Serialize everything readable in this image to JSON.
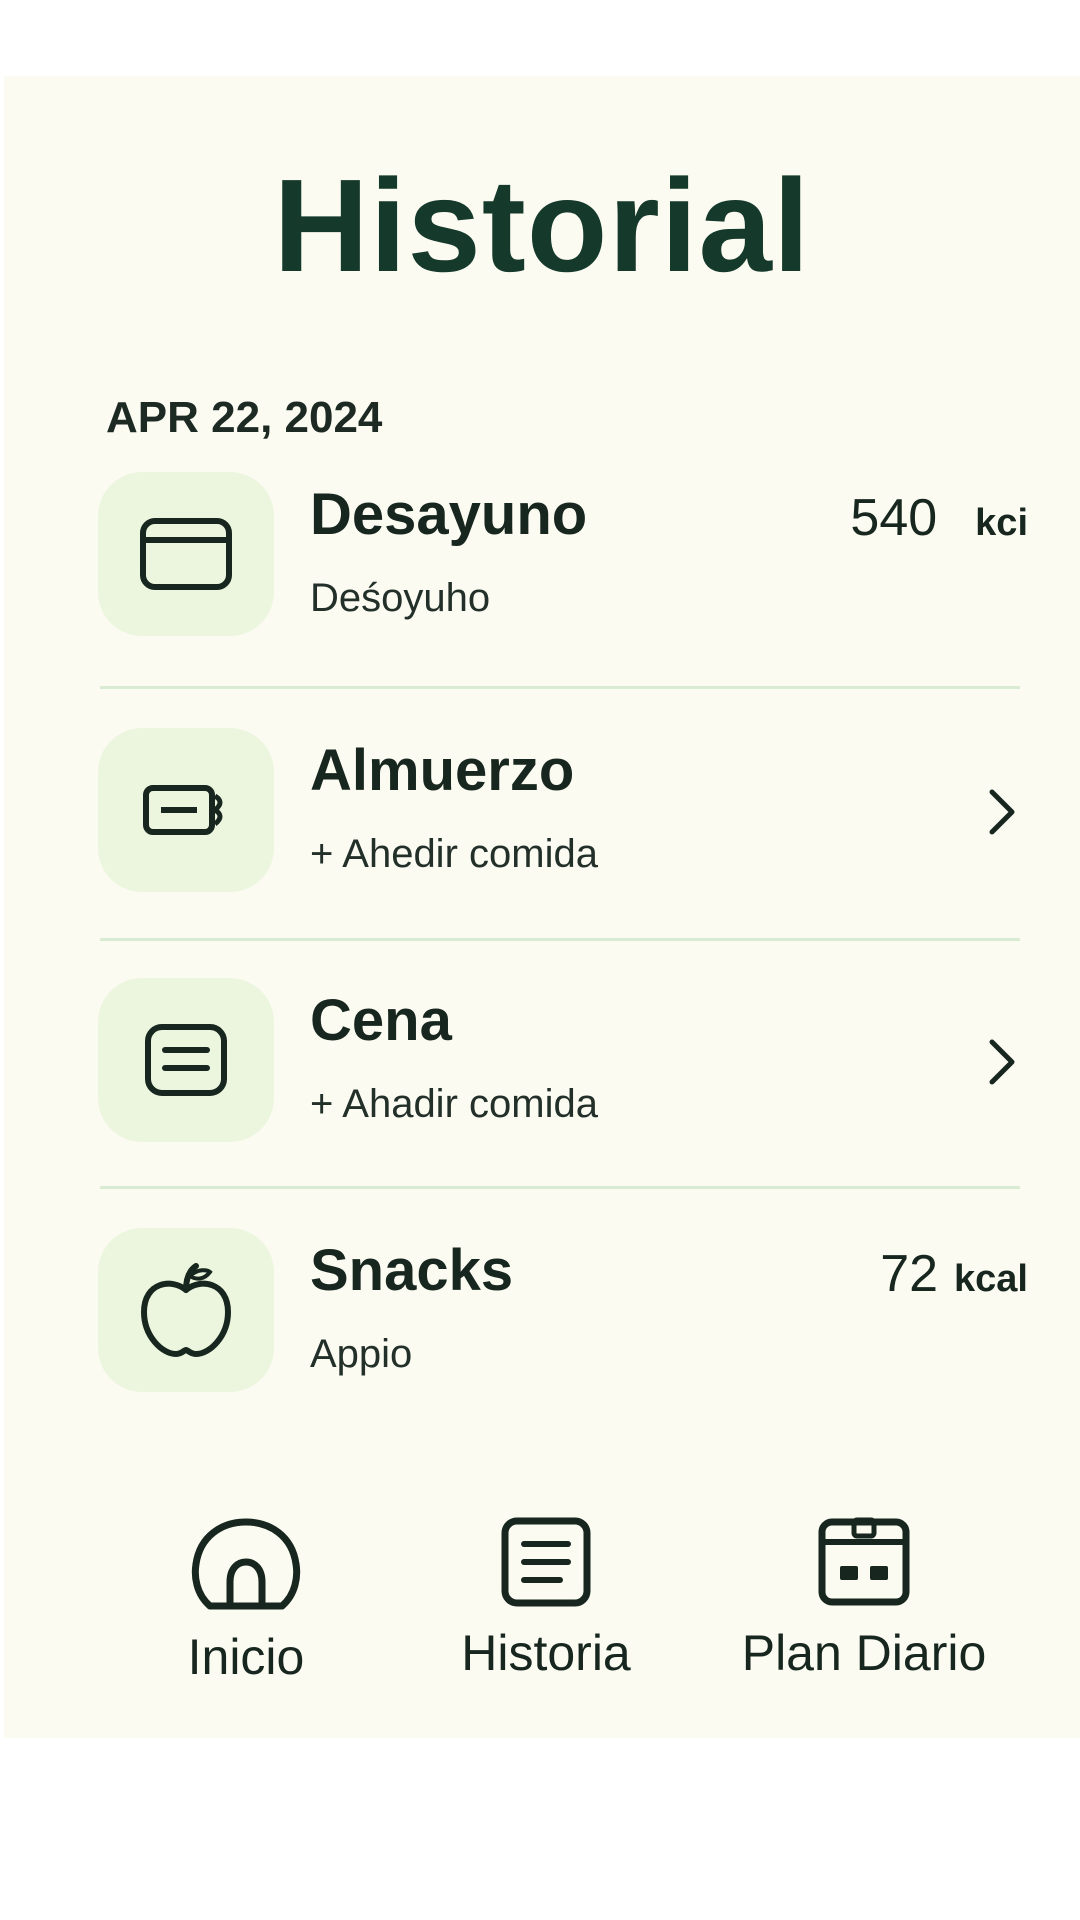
{
  "header": {
    "title": "Historial"
  },
  "date": "APR 22, 2024",
  "meals": [
    {
      "name": "Desayuno",
      "subtitle": "Deśoyuho",
      "calories": "540",
      "unit": "kci",
      "icon": "card-icon"
    },
    {
      "name": "Almuerzo",
      "subtitle": "+ Ahedir comida",
      "icon": "lunchbox-icon"
    },
    {
      "name": "Cena",
      "subtitle": "+ Ahadir comida",
      "icon": "notes-icon"
    },
    {
      "name": "Snacks",
      "subtitle": "Appio",
      "calories": "72",
      "unit": "kcal",
      "icon": "apple-icon"
    }
  ],
  "nav": [
    {
      "label": "Inicio",
      "icon": "home-icon"
    },
    {
      "label": "Historia",
      "icon": "list-icon"
    },
    {
      "label": "Plan Diario",
      "icon": "calendar-icon"
    }
  ],
  "colors": {
    "background": "#fbfbf2",
    "accent": "#15392a",
    "icon_tile": "#ecf6df",
    "divider": "#d9ecd3"
  }
}
